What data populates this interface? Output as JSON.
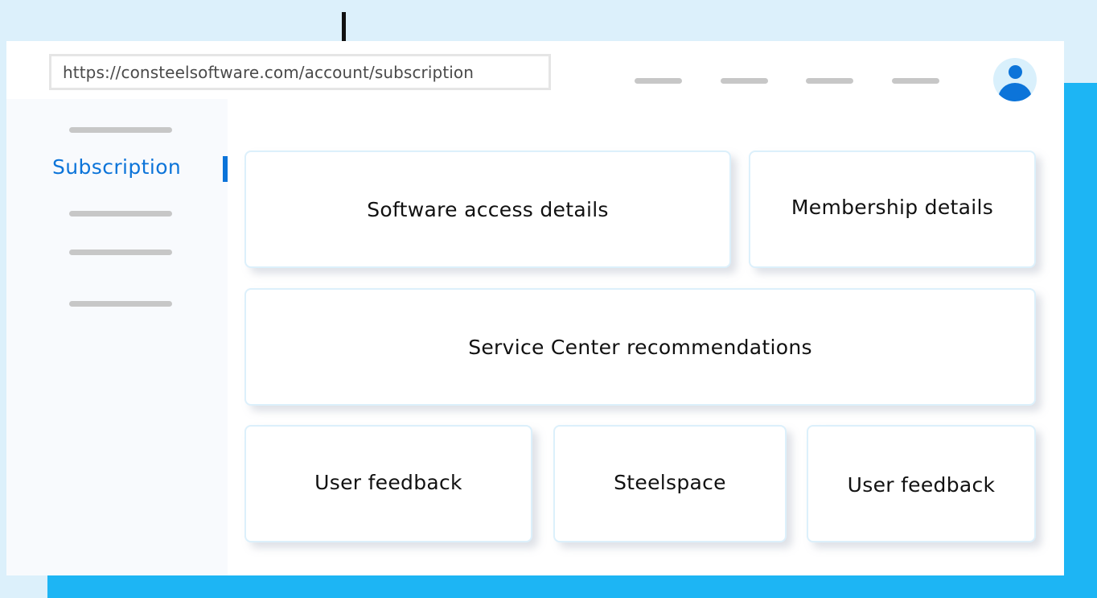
{
  "browser": {
    "url": "https://consteelsoftware.com/account/subscription"
  },
  "sidebar": {
    "active_item_label": "Subscription"
  },
  "cards": {
    "software_access": "Software access details",
    "membership": "Membership details",
    "service_center": "Service Center recommendations",
    "user_feedback_1": "User feedback",
    "steelspace": "Steelspace",
    "user_feedback_2": "User feedback"
  },
  "colors": {
    "background": "#dcf0fb",
    "accent": "#1db5f4",
    "brand_blue": "#0c74d9",
    "placeholder_gray": "#c7c7c7"
  },
  "icons": {
    "avatar": "user-avatar-icon",
    "cursor": "text-cursor-icon"
  }
}
